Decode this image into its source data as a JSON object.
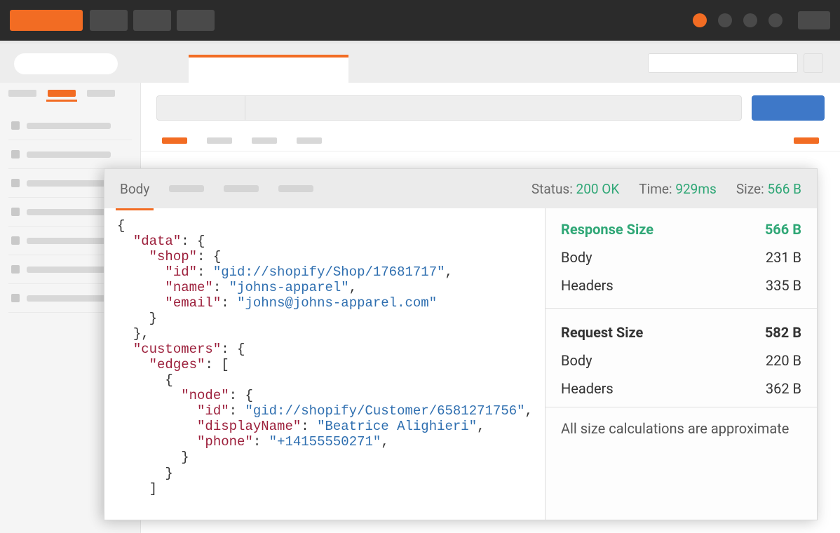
{
  "topbar": {
    "dots": 4,
    "active_dot": 0
  },
  "response": {
    "tabs": {
      "body": "Body"
    },
    "status_label": "Status:",
    "status_value": "200 OK",
    "time_label": "Time:",
    "time_value": "929ms",
    "size_label": "Size:",
    "size_value": "566 B"
  },
  "size_panel": {
    "response": {
      "title": "Response Size",
      "total": "566 B",
      "body_label": "Body",
      "body_value": "231 B",
      "headers_label": "Headers",
      "headers_value": "335 B"
    },
    "request": {
      "title": "Request Size",
      "total": "582 B",
      "body_label": "Body",
      "body_value": "220 B",
      "headers_label": "Headers",
      "headers_value": "362 B"
    },
    "note": "All size calculations are approximate"
  },
  "json_body": {
    "shop_id": "gid://shopify/Shop/17681717",
    "shop_name": "johns-apparel",
    "shop_email": "johns@johns-apparel.com",
    "customer_id": "gid://shopify/Customer/6581271756",
    "customer_displayName": "Beatrice Alighieri",
    "customer_phone": "+14155550271"
  }
}
